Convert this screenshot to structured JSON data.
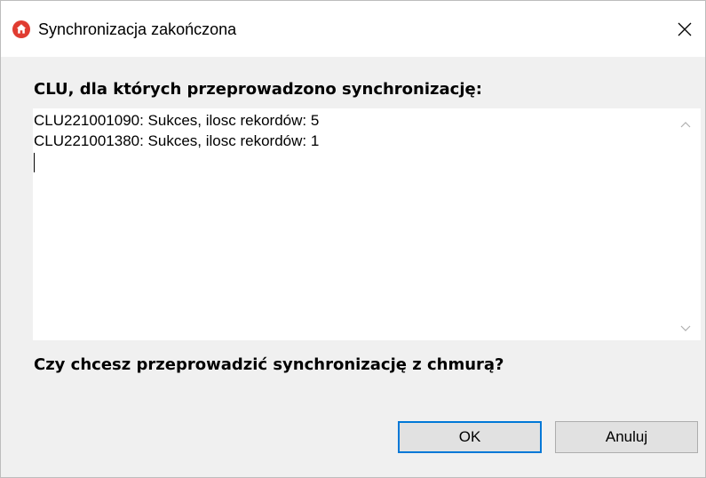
{
  "window": {
    "title": "Synchronizacja zakończona",
    "app_icon": "home-icon",
    "close_icon": "close-icon"
  },
  "dialog": {
    "heading": "CLU, dla których przeprowadzono synchronizację:",
    "log_lines": [
      "CLU221001090: Sukces, ilosc rekordów: 5",
      "CLU221001380: Sukces, ilosc rekordów: 1"
    ],
    "question": "Czy chcesz przeprowadzić synchronizację z chmurą?"
  },
  "buttons": {
    "ok_label": "OK",
    "cancel_label": "Anuluj"
  },
  "colors": {
    "app_icon": "#e03c31",
    "focus_border": "#0078d7",
    "button_bg": "#e1e1e1",
    "dialog_bg": "#f0f0f0"
  }
}
